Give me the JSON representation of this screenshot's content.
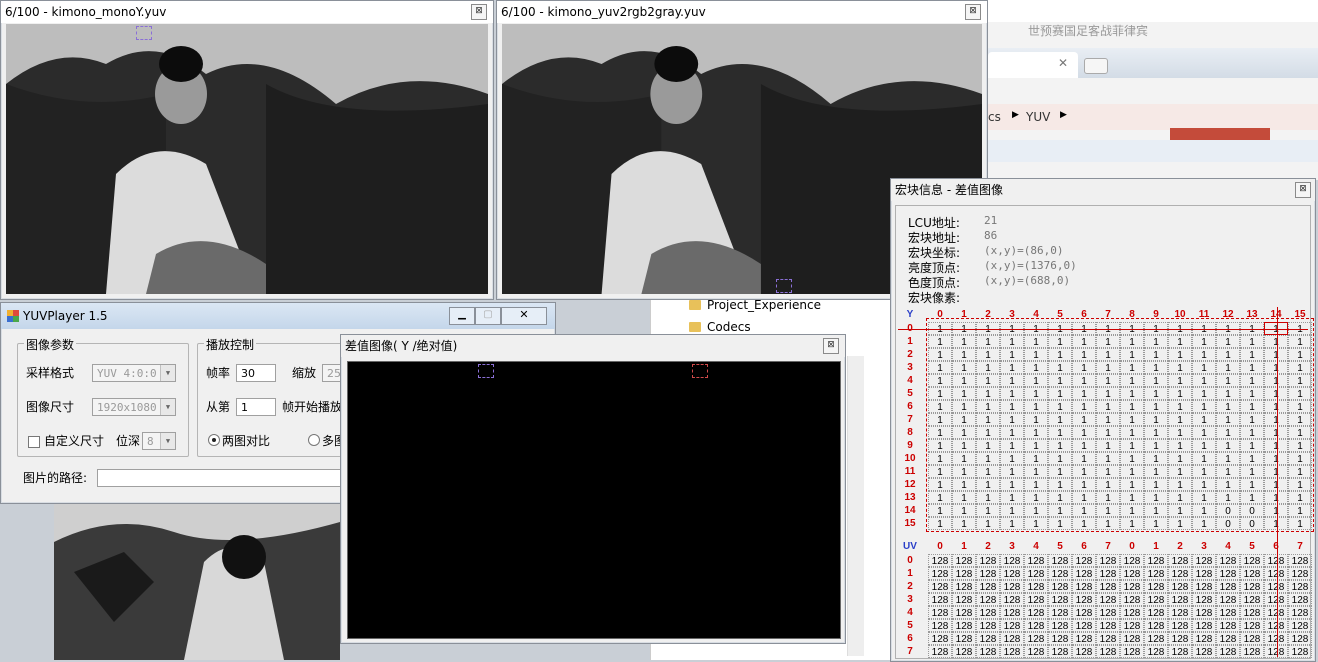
{
  "windows": {
    "left_image": {
      "title": "6/100 - kimono_monoY.yuv"
    },
    "right_image": {
      "title": "6/100 - kimono_yuv2rgb2gray.yuv"
    },
    "player": {
      "title": "YUVPlayer 1.5",
      "image_params": {
        "group_label": "图像参数",
        "sample_format_label": "采样格式",
        "sample_format_value": "YUV 4:0:0",
        "image_size_label": "图像尺寸",
        "image_size_value": "1920x1080",
        "custom_size_label": "自定义尺寸",
        "bit_depth_label": "位深",
        "bit_depth_value": "8"
      },
      "playback": {
        "group_label": "播放控制",
        "fps_label": "帧率",
        "fps_value": "30",
        "zoom_label": "缩放",
        "zoom_value": "25",
        "from_label": "从第",
        "from_value": "1",
        "start_label": "帧开始播放",
        "compare_two": "两图对比",
        "compare_multi": "多图"
      },
      "path_label": "图片的路径:"
    },
    "diff": {
      "title": "差值图像( Y /绝对值)"
    },
    "macro": {
      "title": "宏块信息 - 差值图像",
      "info": [
        {
          "label": "LCU地址:",
          "value": "21"
        },
        {
          "label": "宏块地址:",
          "value": "86"
        },
        {
          "label": "宏块坐标:",
          "value": "(x,y)=(86,0)"
        },
        {
          "label": "亮度顶点:",
          "value": "(x,y)=(1376,0)"
        },
        {
          "label": "色度顶点:",
          "value": "(x,y)=(688,0)"
        },
        {
          "label": "宏块像素:",
          "value": ""
        }
      ],
      "y_label": "Y",
      "uv_label": "UV",
      "y_cols": [
        "0",
        "1",
        "2",
        "3",
        "4",
        "5",
        "6",
        "7",
        "8",
        "9",
        "10",
        "11",
        "12",
        "13",
        "14",
        "15"
      ],
      "y_rows": [
        [
          "1",
          "1",
          "1",
          "1",
          "1",
          "1",
          "1",
          "1",
          "1",
          "1",
          "1",
          "1",
          "1",
          "1",
          "1",
          "1"
        ],
        [
          "1",
          "1",
          "1",
          "1",
          "1",
          "1",
          "1",
          "1",
          "1",
          "1",
          "1",
          "1",
          "1",
          "1",
          "1",
          "1"
        ],
        [
          "1",
          "1",
          "1",
          "1",
          "1",
          "1",
          "1",
          "1",
          "1",
          "1",
          "1",
          "1",
          "1",
          "1",
          "1",
          "1"
        ],
        [
          "1",
          "1",
          "1",
          "1",
          "1",
          "1",
          "1",
          "1",
          "1",
          "1",
          "1",
          "1",
          "1",
          "1",
          "1",
          "1"
        ],
        [
          "1",
          "1",
          "1",
          "1",
          "1",
          "1",
          "1",
          "1",
          "1",
          "1",
          "1",
          "1",
          "1",
          "1",
          "1",
          "1"
        ],
        [
          "1",
          "1",
          "1",
          "1",
          "1",
          "1",
          "1",
          "1",
          "1",
          "1",
          "1",
          "1",
          "1",
          "1",
          "1",
          "1"
        ],
        [
          "1",
          "1",
          "1",
          "1",
          "1",
          "1",
          "1",
          "1",
          "1",
          "1",
          "1",
          "1",
          "1",
          "1",
          "1",
          "1"
        ],
        [
          "1",
          "1",
          "1",
          "1",
          "1",
          "1",
          "1",
          "1",
          "1",
          "1",
          "1",
          "1",
          "1",
          "1",
          "1",
          "1"
        ],
        [
          "1",
          "1",
          "1",
          "1",
          "1",
          "1",
          "1",
          "1",
          "1",
          "1",
          "1",
          "1",
          "1",
          "1",
          "1",
          "1"
        ],
        [
          "1",
          "1",
          "1",
          "1",
          "1",
          "1",
          "1",
          "1",
          "1",
          "1",
          "1",
          "1",
          "1",
          "1",
          "1",
          "1"
        ],
        [
          "1",
          "1",
          "1",
          "1",
          "1",
          "1",
          "1",
          "1",
          "1",
          "1",
          "1",
          "1",
          "1",
          "1",
          "1",
          "1"
        ],
        [
          "1",
          "1",
          "1",
          "1",
          "1",
          "1",
          "1",
          "1",
          "1",
          "1",
          "1",
          "1",
          "1",
          "1",
          "1",
          "1"
        ],
        [
          "1",
          "1",
          "1",
          "1",
          "1",
          "1",
          "1",
          "1",
          "1",
          "1",
          "1",
          "1",
          "1",
          "1",
          "1",
          "1"
        ],
        [
          "1",
          "1",
          "1",
          "1",
          "1",
          "1",
          "1",
          "1",
          "1",
          "1",
          "1",
          "1",
          "1",
          "1",
          "1",
          "1"
        ],
        [
          "1",
          "1",
          "1",
          "1",
          "1",
          "1",
          "1",
          "1",
          "1",
          "1",
          "1",
          "1",
          "0",
          "0",
          "1",
          "1"
        ],
        [
          "1",
          "1",
          "1",
          "1",
          "1",
          "1",
          "1",
          "1",
          "1",
          "1",
          "1",
          "1",
          "0",
          "0",
          "1",
          "1"
        ]
      ],
      "uv_cols": [
        "0",
        "1",
        "2",
        "3",
        "4",
        "5",
        "6",
        "7",
        "0",
        "1",
        "2",
        "3",
        "4",
        "5",
        "6",
        "7"
      ],
      "uv_rows": [
        "0",
        "1",
        "2",
        "3",
        "4",
        "5",
        "6",
        "7"
      ],
      "uv_value": "128"
    }
  },
  "background": {
    "browser_text": "世预赛国足客战菲律宾",
    "breadcrumb_cs": "cs",
    "breadcrumb_yuv": "YUV",
    "folder_items": [
      "Project_Experience",
      "Codecs"
    ]
  }
}
